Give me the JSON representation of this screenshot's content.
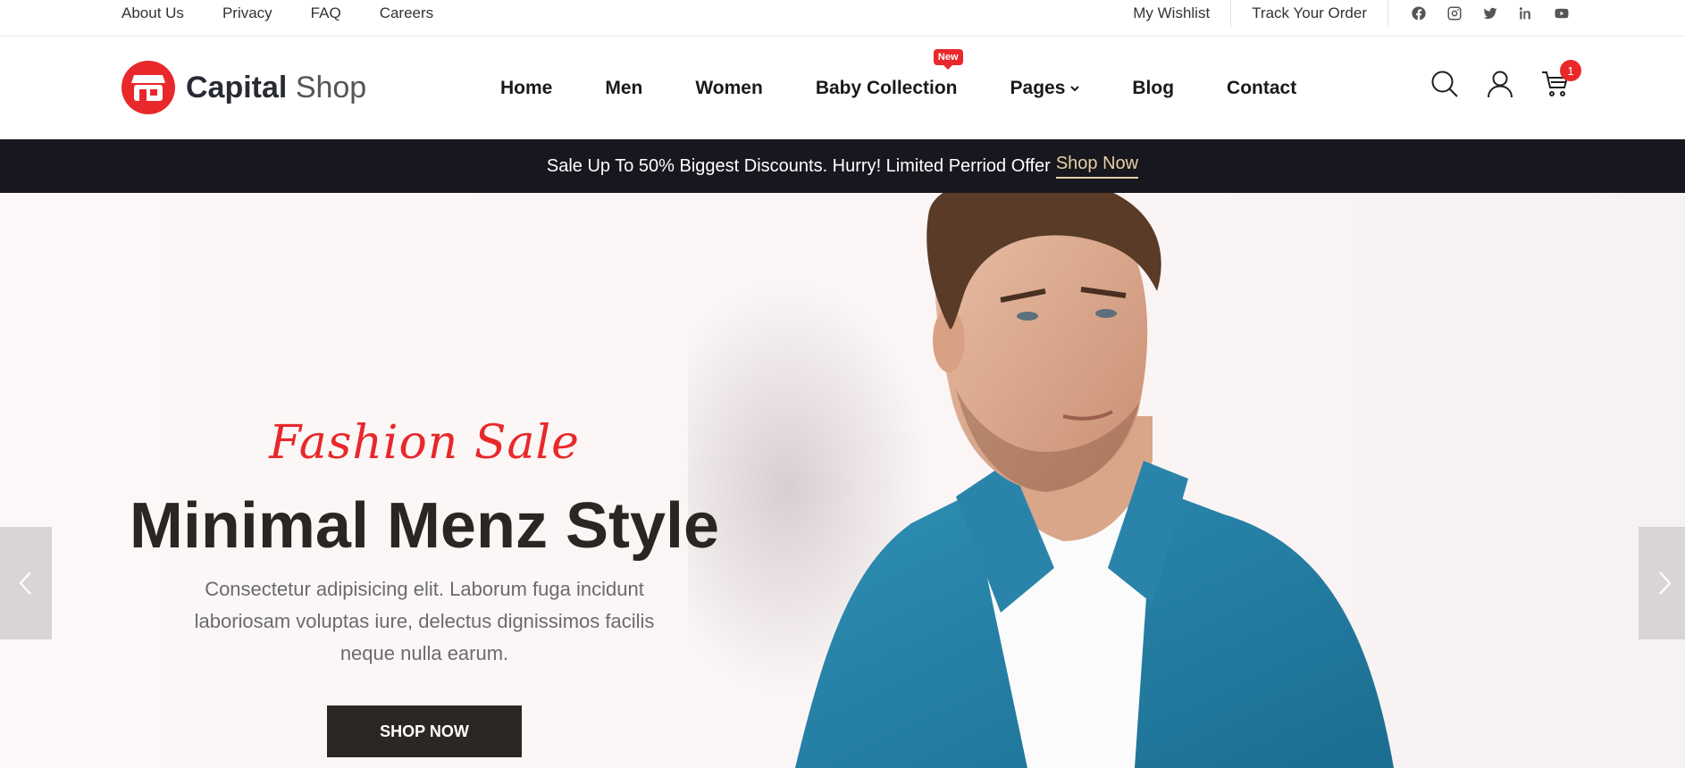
{
  "topbar": {
    "links": [
      "About Us",
      "Privacy",
      "FAQ",
      "Careers"
    ],
    "wishlist": "My Wishlist",
    "track_order": "Track Your Order",
    "socials": [
      "facebook-icon",
      "instagram-icon",
      "twitter-icon",
      "linkedin-icon",
      "youtube-icon"
    ]
  },
  "brand": {
    "name_bold": "Capital",
    "name_light": "Shop",
    "color": "#e8282b"
  },
  "nav": {
    "items": [
      "Home",
      "Men",
      "Women",
      "Baby Collection",
      "Pages",
      "Blog",
      "Contact"
    ],
    "new_badge": "New"
  },
  "header_icons": {
    "cart_count": "1"
  },
  "promo": {
    "text": "Sale Up To 50% Biggest Discounts. Hurry! Limited Perriod Offer",
    "link": "Shop Now"
  },
  "hero": {
    "script": "Fashion Sale",
    "title": "Minimal Menz Style",
    "description": "Consectetur adipisicing elit. Laborum fuga incidunt laboriosam voluptas iure, delectus dignissimos facilis neque nulla earum.",
    "button": "SHOP NOW"
  }
}
